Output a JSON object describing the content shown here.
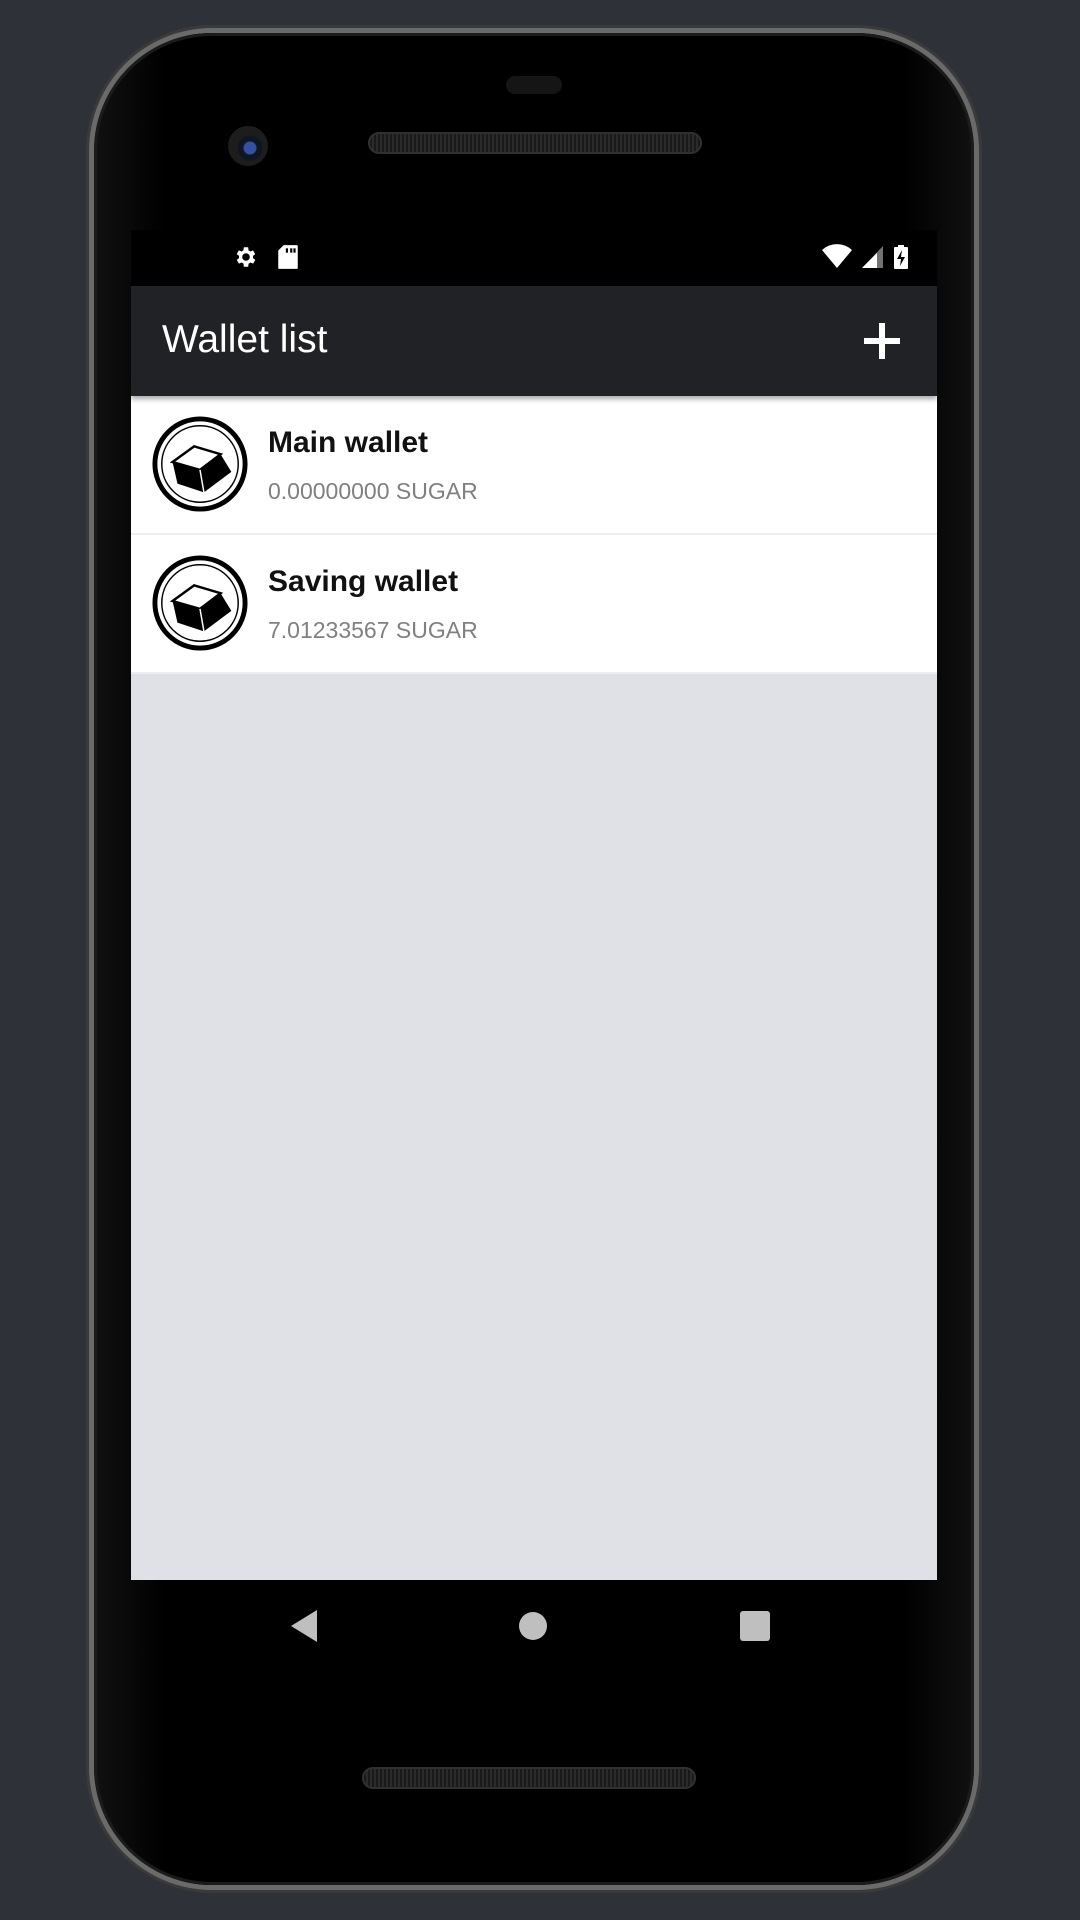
{
  "status_bar": {
    "left_icons": [
      "gear-icon",
      "sd-card-icon"
    ],
    "right_icons": [
      "wifi-icon",
      "cell-signal-icon",
      "battery-charging-icon"
    ]
  },
  "app_bar": {
    "title": "Wallet list",
    "add_button_icon": "plus-icon"
  },
  "wallets": [
    {
      "name": "Main wallet",
      "balance": "0.00000000 SUGAR",
      "icon": "sugar-cube-icon"
    },
    {
      "name": "Saving wallet",
      "balance": "7.01233567 SUGAR",
      "icon": "sugar-cube-icon"
    }
  ],
  "nav_bar": {
    "back_icon": "back-triangle-icon",
    "home_icon": "home-circle-icon",
    "recent_icon": "recent-square-icon"
  },
  "colors": {
    "app_bar": "#212225",
    "list_background": "#dfe1e6",
    "row_background": "#ffffff",
    "balance_text": "#808080"
  }
}
